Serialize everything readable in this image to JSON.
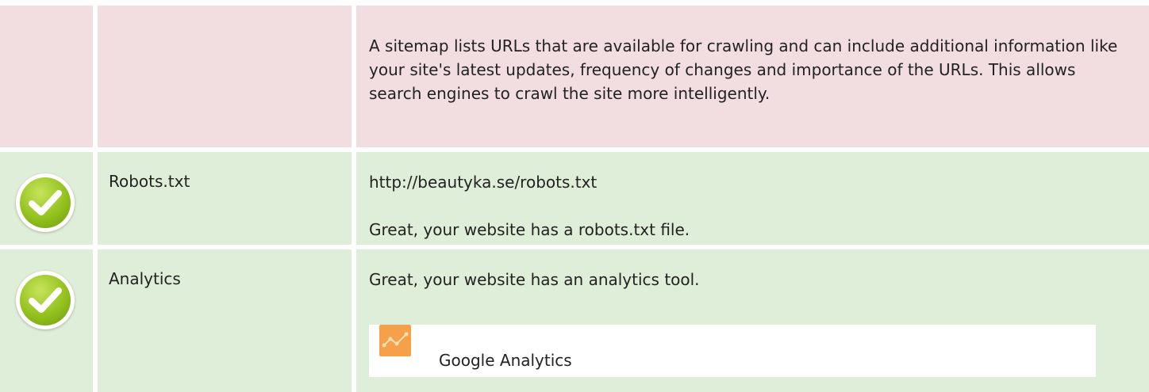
{
  "sitemap": {
    "description": "A sitemap lists URLs that are available for crawling and can include additional information like your site's latest updates, frequency of changes and importance of the URLs. This allows search engines to crawl the site more intelligently."
  },
  "robots": {
    "label": "Robots.txt",
    "status_icon": "check-icon",
    "url": "http://beautyka.se/robots.txt",
    "message": "Great, your website has a robots.txt file."
  },
  "analytics": {
    "label": "Analytics",
    "status_icon": "check-icon",
    "message": "Great, your website has an analytics tool.",
    "tools": [
      {
        "name": "Google Analytics",
        "icon": "google-analytics-icon"
      }
    ]
  },
  "colors": {
    "warning_row": "#f2dee0",
    "success_row": "#dfeed8",
    "check_green": "#93c11e",
    "analytics_orange": "#f6a04a"
  }
}
